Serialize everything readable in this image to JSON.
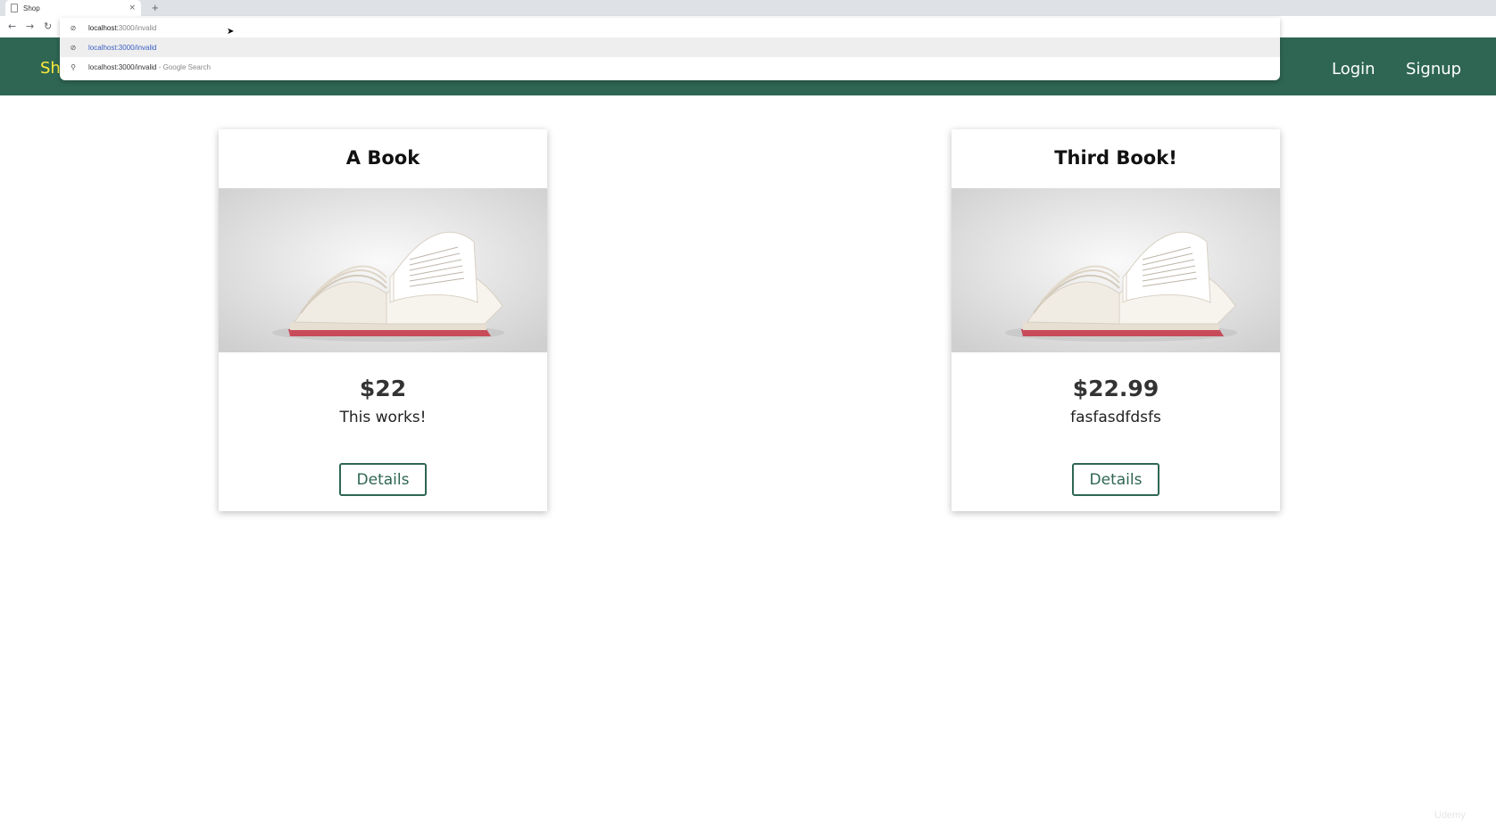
{
  "browser": {
    "tab_title": "Shop",
    "tab_close": "×",
    "new_tab": "+",
    "back": "←",
    "forward": "→",
    "reload": "↻",
    "address_typed": "localhost:",
    "address_rest": "3000/invalid",
    "suggestion_url": "localhost:3000/invalid",
    "suggestion_search_query": "localhost:3000/invalid",
    "suggestion_search_suffix": " - Google Search",
    "extension_colors": [
      "#c9c9c9",
      "#d93025",
      "#1a8f3a",
      "#e0a800",
      "#c9c9c9",
      "#9aa0a6",
      "#c9c9c9",
      "#3949ab",
      "#d93025",
      "#222222"
    ]
  },
  "header": {
    "brand": "Sh",
    "nav": {
      "login": "Login",
      "signup": "Signup"
    },
    "colors": {
      "background": "#2e6653",
      "brand": "#ffeb3b"
    }
  },
  "products": [
    {
      "title": "A Book",
      "price": "$22",
      "description": "This works!",
      "button": "Details",
      "image": "open-book"
    },
    {
      "title": "Third Book!",
      "price": "$22.99",
      "description": "fasfasdfdsfs",
      "button": "Details",
      "image": "open-book"
    }
  ],
  "watermark": "Udemy"
}
